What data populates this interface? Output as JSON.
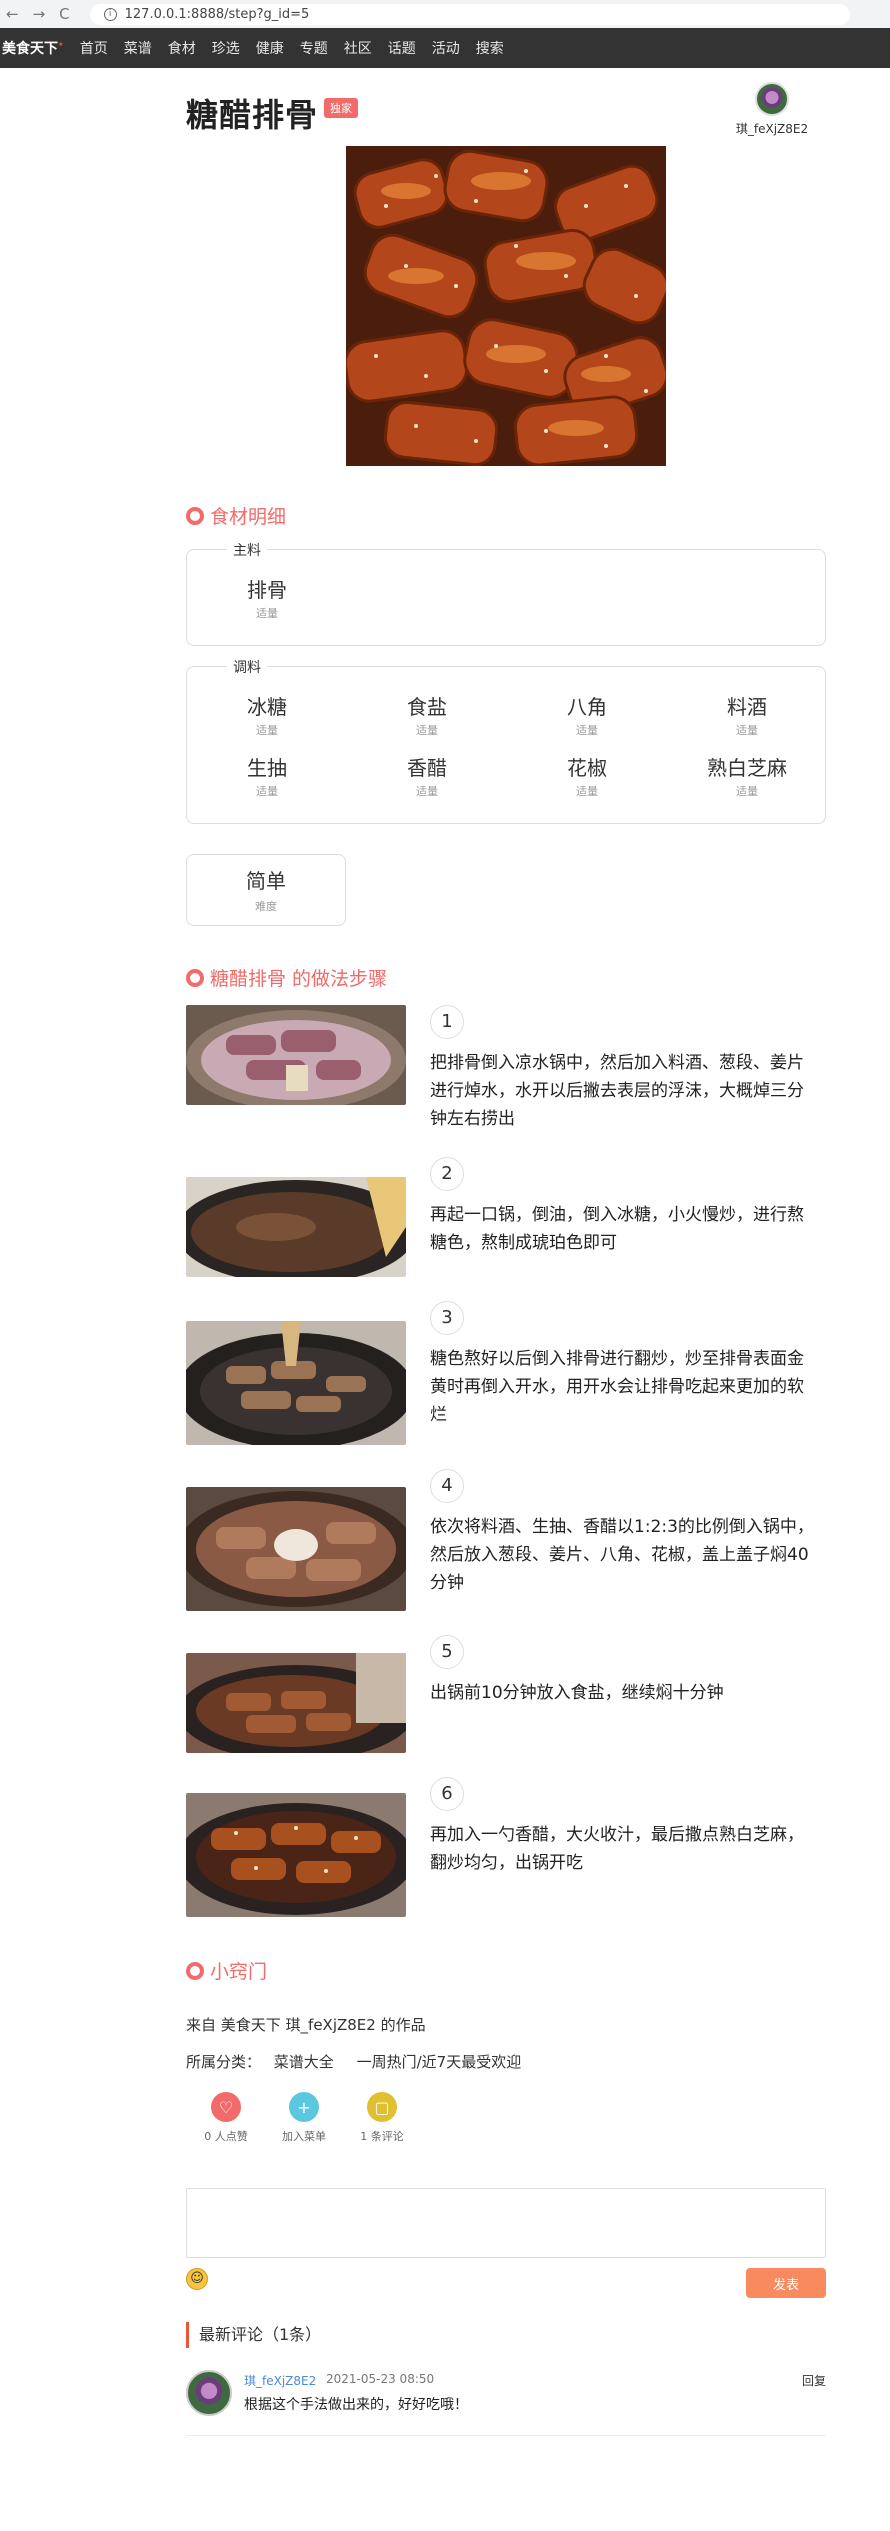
{
  "browser": {
    "url": "127.0.0.1:8888/step?g_id=5",
    "back": "←",
    "forward": "→",
    "reload": "C",
    "info": "i"
  },
  "nav": {
    "brand": "美食天下",
    "items": [
      "首页",
      "菜谱",
      "食材",
      "珍选",
      "健康",
      "专题",
      "社区",
      "话题",
      "活动",
      "搜索"
    ]
  },
  "recipe": {
    "title": "糖醋排骨",
    "badge": "独家",
    "author": "琪_feXjZ8E2"
  },
  "ingredients": {
    "section_title": "食材明细",
    "main_label": "主料",
    "main": [
      {
        "name": "排骨",
        "qty": "适量"
      }
    ],
    "seasoning_label": "调料",
    "seasoning": [
      {
        "name": "冰糖",
        "qty": "适量"
      },
      {
        "name": "食盐",
        "qty": "适量"
      },
      {
        "name": "八角",
        "qty": "适量"
      },
      {
        "name": "料酒",
        "qty": "适量"
      },
      {
        "name": "生抽",
        "qty": "适量"
      },
      {
        "name": "香醋",
        "qty": "适量"
      },
      {
        "name": "花椒",
        "qty": "适量"
      },
      {
        "name": "熟白芝麻",
        "qty": "适量"
      }
    ],
    "difficulty": {
      "value": "简单",
      "label": "难度"
    }
  },
  "steps": {
    "title": "糖醋排骨 的做法步骤",
    "items": [
      {
        "num": "1",
        "text": "把排骨倒入凉水锅中，然后加入料酒、葱段、姜片进行焯水，水开以后撇去表层的浮沫，大概焯三分钟左右捞出"
      },
      {
        "num": "2",
        "text": "再起一口锅，倒油，倒入冰糖，小火慢炒，进行熬糖色，熬制成琥珀色即可"
      },
      {
        "num": "3",
        "text": "糖色熬好以后倒入排骨进行翻炒，炒至排骨表面金黄时再倒入开水，用开水会让排骨吃起来更加的软烂"
      },
      {
        "num": "4",
        "text": "依次将料酒、生抽、香醋以1:2:3的比例倒入锅中，然后放入葱段、姜片、八角、花椒，盖上盖子焖40分钟"
      },
      {
        "num": "5",
        "text": "出锅前10分钟放入食盐，继续焖十分钟"
      },
      {
        "num": "6",
        "text": "再加入一勺香醋，大火收汁，最后撒点熟白芝麻，翻炒均匀，出锅开吃"
      }
    ]
  },
  "tips": {
    "title": "小窍门",
    "from": "来自 美食天下 琪_feXjZ8E2 的作品",
    "category_label": "所属分类：",
    "categories": [
      "菜谱大全",
      "一周热门/近7天最受欢迎"
    ],
    "actions": [
      {
        "label": "0 人点赞",
        "icon": "like-icon",
        "color": "#f36a6a"
      },
      {
        "label": "加入菜单",
        "icon": "plus-icon",
        "color": "#5bc8e0"
      },
      {
        "label": "1 条评论",
        "icon": "comment-icon",
        "color": "#e0c030"
      }
    ]
  },
  "comments": {
    "send_label": "发表",
    "header": "最新评论（1条）",
    "items": [
      {
        "user": "琪_feXjZ8E2",
        "time": "2021-05-23 08:50",
        "reply": "回复",
        "text": "根据这个手法做出来的，好好吃哦！"
      }
    ]
  }
}
